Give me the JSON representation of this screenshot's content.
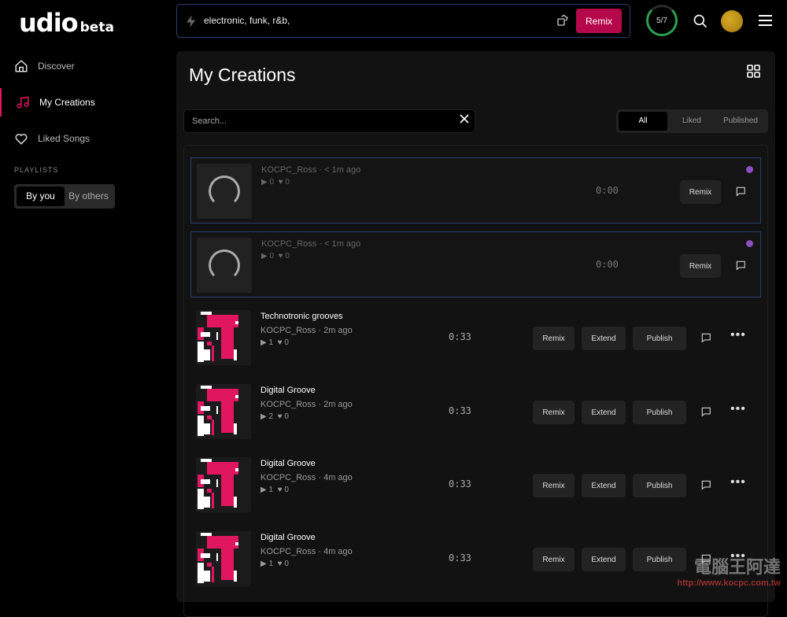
{
  "brand": {
    "name": "udio",
    "tag": "beta"
  },
  "sidebar": {
    "items": [
      {
        "label": "Discover",
        "icon": "home-icon"
      },
      {
        "label": "My Creations",
        "icon": "music-note-icon",
        "active": true
      },
      {
        "label": "Liked Songs",
        "icon": "heart-icon"
      }
    ],
    "playlists_label": "PLAYLISTS",
    "playlist_tabs": [
      "By you",
      "By others"
    ],
    "playlist_selected": "By you"
  },
  "topbar": {
    "prompt": "electronic, funk, r&b,",
    "remix_label": "Remix",
    "credits": "5/7",
    "accent": "#b5084a"
  },
  "main": {
    "title": "My Creations",
    "search_placeholder": "Search...",
    "filters": [
      "All",
      "Liked",
      "Published"
    ],
    "filter_selected": "All",
    "rows": [
      {
        "pending": true,
        "title": "",
        "author": "KOCPC_Ross",
        "age": "< 1m ago",
        "plays": "0",
        "likes": "0",
        "duration": "0:00"
      },
      {
        "pending": true,
        "title": "",
        "author": "KOCPC_Ross",
        "age": "< 1m ago",
        "plays": "0",
        "likes": "0",
        "duration": "0:00"
      },
      {
        "title": "Technotronic grooves",
        "author": "KOCPC_Ross",
        "age": "2m ago",
        "plays": "1",
        "likes": "0",
        "duration": "0:33"
      },
      {
        "title": "Digital Groove",
        "author": "KOCPC_Ross",
        "age": "2m ago",
        "plays": "2",
        "likes": "0",
        "duration": "0:33"
      },
      {
        "title": "Digital Groove",
        "author": "KOCPC_Ross",
        "age": "4m ago",
        "plays": "1",
        "likes": "0",
        "duration": "0:33"
      },
      {
        "title": "Digital Groove",
        "author": "KOCPC_Ross",
        "age": "4m ago",
        "plays": "1",
        "likes": "0",
        "duration": "0:33"
      }
    ],
    "row_buttons": {
      "remix": "Remix",
      "extend": "Extend",
      "publish": "Publish"
    }
  },
  "watermark": {
    "text": "電腦王阿達",
    "url": "http://www.kocpc.com.tw"
  }
}
